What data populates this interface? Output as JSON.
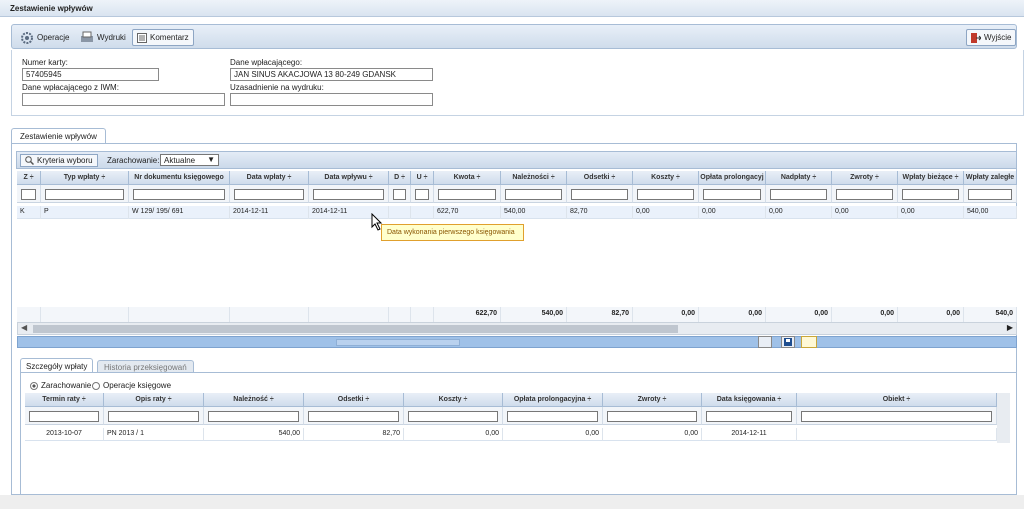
{
  "window": {
    "title": "Zestawienie wpływów"
  },
  "toolbar": {
    "operacje": "Operacje",
    "wydruki": "Wydruki",
    "komentarz": "Komentarz",
    "wyjscie": "Wyjście"
  },
  "form": {
    "numer_karty_label": "Numer karty:",
    "numer_karty_value": "57405945",
    "dane_wplacajacego_label": "Dane wpłacającego:",
    "dane_wplacajacego_value": "JAN SINUS AKACJOWA 13 80-249 GDANSK",
    "dane_iwm_label": "Dane wpłacającego z IWM:",
    "dane_iwm_value": "",
    "uzasadnienie_label": "Uzasadnienie na wydruku:",
    "uzasadnienie_value": ""
  },
  "main_tab": "Zestawienie wpływów",
  "grid_toolbar": {
    "kryteria": "Kryteria wyboru",
    "zarachowanie_label": "Zarachowanie:",
    "zarachowanie_value": "Aktualne"
  },
  "main_grid": {
    "headers": [
      "Z ÷",
      "Typ wpłaty ÷",
      "Nr dokumentu księgowego",
      "Data wpłaty ÷",
      "Data wpływu ÷",
      "D ÷",
      "U ÷",
      "Kwota ÷",
      "Należności ÷",
      "Odsetki ÷",
      "Koszty ÷",
      "Opłata prolongacyj",
      "Nadpłaty ÷",
      "Zwroty ÷",
      "Wpłaty bieżące ÷",
      "Wpłaty zaległe"
    ],
    "row": [
      "K",
      "P",
      "W 129/ 195/ 691",
      "2014-12-11",
      "2014-12-11",
      "",
      "",
      "622,70",
      "540,00",
      "82,70",
      "0,00",
      "0,00",
      "0,00",
      "0,00",
      "0,00",
      "540,00"
    ],
    "sums": [
      "",
      "",
      "",
      "",
      "",
      "",
      "",
      "622,70",
      "540,00",
      "82,70",
      "0,00",
      "0,00",
      "0,00",
      "0,00",
      "0,00",
      "540,0"
    ]
  },
  "tooltip": "Data wykonania pierwszego księgowania",
  "sub_tabs": {
    "szczegoly": "Szczegóły wpłaty",
    "historia": "Historia przeksięgowań"
  },
  "radios": {
    "zarachowanie": "Zarachowanie",
    "operacje": "Operacje księgowe"
  },
  "detail_grid": {
    "headers": [
      "Termin raty ÷",
      "Opis raty ÷",
      "Należność ÷",
      "Odsetki ÷",
      "Koszty ÷",
      "Opłata prolongacyjna ÷",
      "Zwroty ÷",
      "Data księgowania ÷",
      "Obiekt ÷"
    ],
    "row": [
      "2013-10-07",
      "PN 2013 / 1",
      "540,00",
      "82,70",
      "0,00",
      "0,00",
      "0,00",
      "2014-12-11",
      ""
    ]
  }
}
